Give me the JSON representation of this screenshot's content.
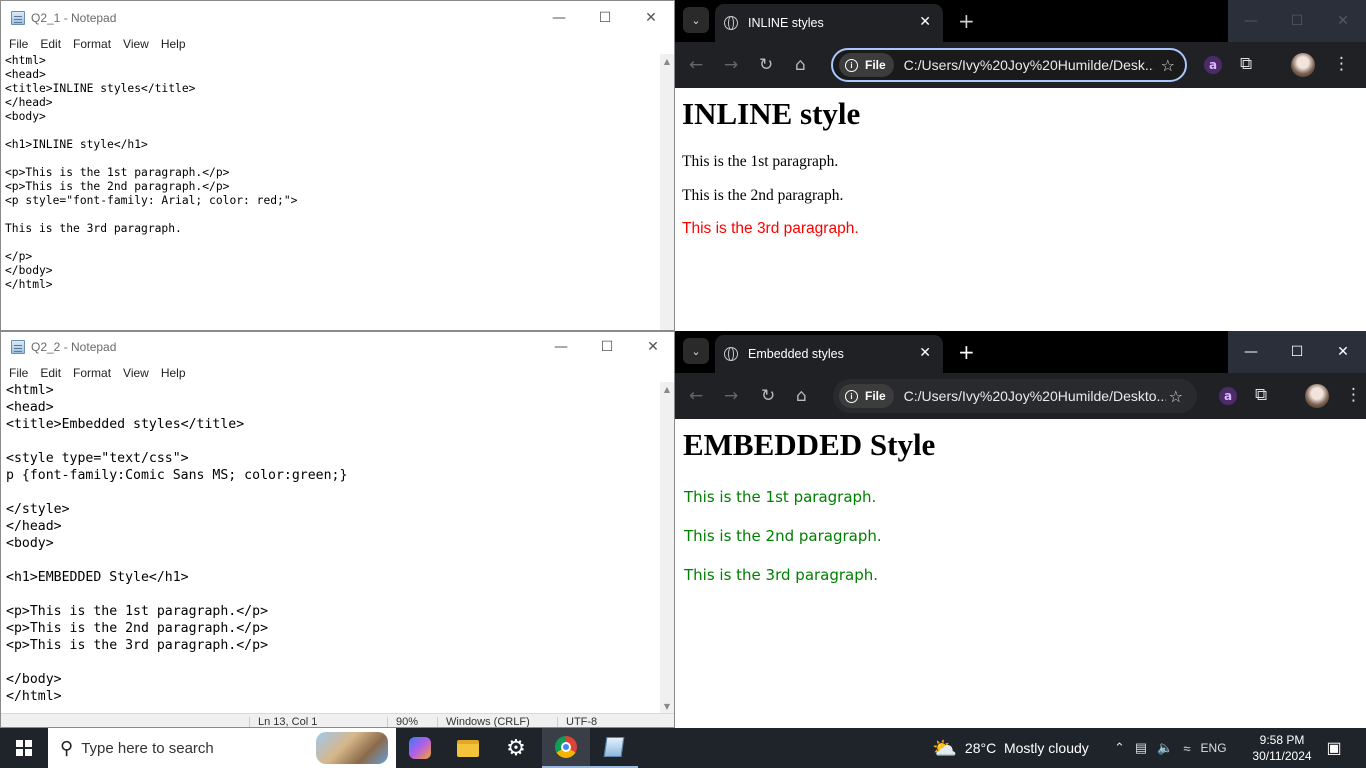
{
  "notepad1": {
    "title": "Q2_1 - Notepad",
    "menu": [
      "File",
      "Edit",
      "Format",
      "View",
      "Help"
    ],
    "lines": [
      "<html>",
      "<head>",
      "<title>INLINE styles</title>",
      "</head>",
      "<body>",
      "",
      "<h1>INLINE style</h1>",
      "",
      "<p>This is the 1st paragraph.</p>",
      "<p>This is the 2nd paragraph.</p>",
      "<p style=\"font-family: Arial; color: red;\">",
      "",
      "This is the 3rd paragraph.",
      "",
      "</p>",
      "</body>",
      "</html>"
    ]
  },
  "notepad2": {
    "title": "Q2_2 - Notepad",
    "menu": [
      "File",
      "Edit",
      "Format",
      "View",
      "Help"
    ],
    "lines": [
      "<html>",
      "<head>",
      "<title>Embedded styles</title>",
      "",
      "<style type=\"text/css\">",
      "p {font-family:Comic Sans MS; color:green;}",
      "",
      "</style>",
      "</head>",
      "<body>",
      "",
      "<h1>EMBEDDED Style</h1>",
      "",
      "<p>This is the 1st paragraph.</p>",
      "<p>This is the 2nd paragraph.</p>",
      "<p>This is the 3rd paragraph.</p>",
      "",
      "</body>",
      "</html>"
    ],
    "status": {
      "position": "Ln 13, Col 1",
      "zoom": "90%",
      "line_ending": "Windows (CRLF)",
      "encoding": "UTF-8"
    }
  },
  "browser1": {
    "tab_title": "INLINE styles",
    "file_chip": "File",
    "url": "C:/Users/Ivy%20Joy%20Humilde/Desk...",
    "page": {
      "heading": "INLINE style",
      "p1": "This is the 1st paragraph.",
      "p2": "This is the 2nd paragraph.",
      "p3": "This is the 3rd paragraph."
    }
  },
  "browser2": {
    "tab_title": "Embedded styles",
    "file_chip": "File",
    "url": "C:/Users/Ivy%20Joy%20Humilde/Deskto...",
    "page": {
      "heading": "EMBEDDED Style",
      "p1": "This is the 1st paragraph.",
      "p2": "This is the 2nd paragraph.",
      "p3": "This is the 3rd paragraph."
    }
  },
  "taskbar": {
    "search_placeholder": "Type here to search",
    "weather": "28°C  Mostly cloudy",
    "language": "ENG",
    "time": "9:58 PM",
    "date": "30/11/2024"
  },
  "colors": {
    "inline_red": "#ff0000",
    "embedded_green": "#008000",
    "browser_chrome": "#202124",
    "taskbar": "#1f242b"
  },
  "icons": [
    "notepad-icon",
    "globe-icon",
    "back-arrow-icon",
    "forward-arrow-icon",
    "reload-icon",
    "home-icon",
    "info-icon",
    "star-icon",
    "extension-a-icon",
    "puzzle-icon",
    "profile-avatar-icon",
    "menu-dots-icon",
    "windows-start-icon",
    "search-icon",
    "copilot-icon",
    "file-explorer-icon",
    "settings-gear-icon",
    "chrome-icon",
    "notepad-taskbar-icon",
    "weather-cloud-icon",
    "chevron-up-icon",
    "network-icon",
    "volume-icon",
    "wifi-icon",
    "notification-icon"
  ]
}
